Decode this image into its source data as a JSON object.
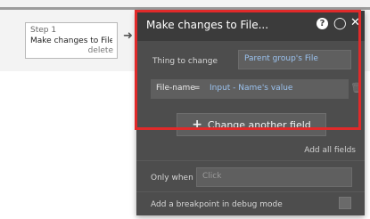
{
  "workflow": {
    "step_number": "Step 1",
    "step_title": "Make changes to File...",
    "delete_label": "delete"
  },
  "panel": {
    "title": "Make changes to File...",
    "thing_label": "Thing to change",
    "thing_value": "Parent group's File",
    "field_name": "File-name",
    "field_equals": "=",
    "field_value": "Input - Name's value",
    "change_button": "Change another field",
    "add_all": "Add all fields",
    "only_when_label": "Only when",
    "only_when_placeholder": "Click",
    "breakpoint_label": "Add a breakpoint in debug mode"
  },
  "colors": {
    "highlight": "#e02a2a",
    "dynamic_text": "#9bc3f0",
    "panel_bg": "#4d4d4d"
  }
}
